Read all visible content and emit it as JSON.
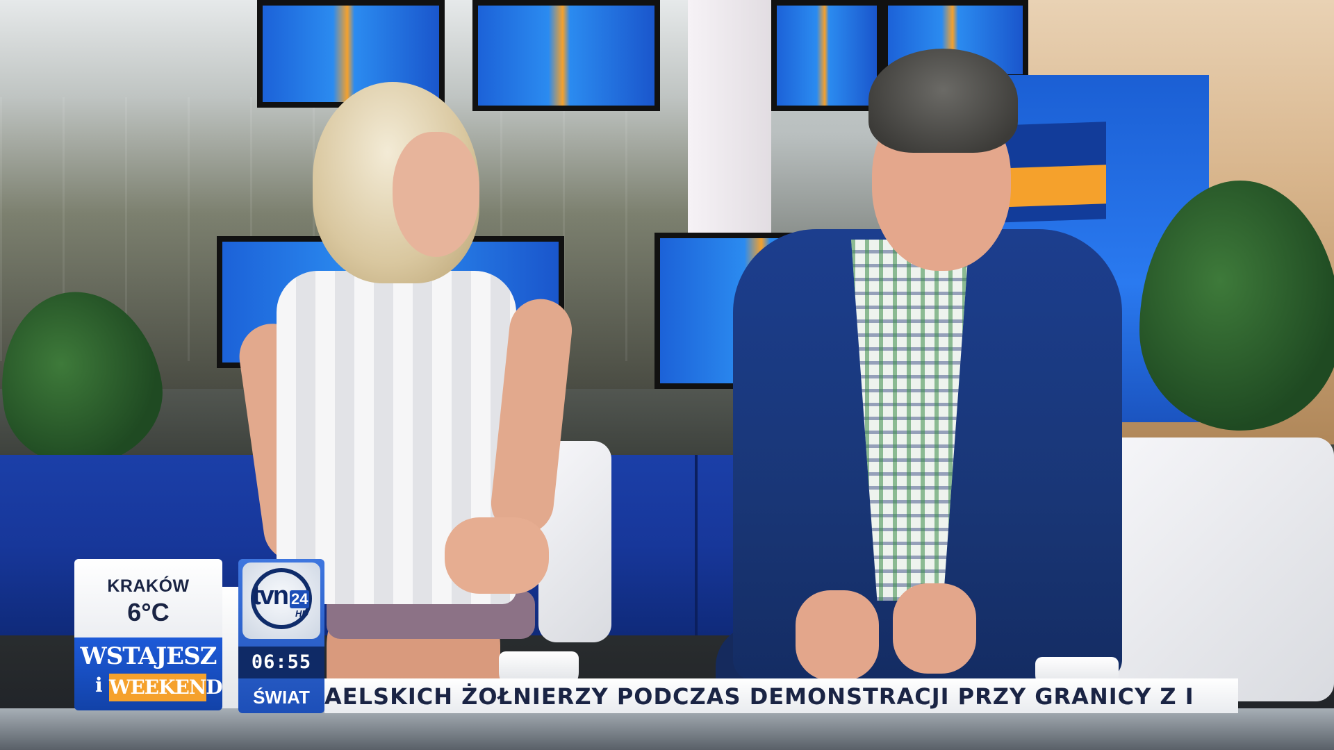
{
  "overlay": {
    "weather": {
      "city": "KRAKÓW",
      "temperature": "6°C"
    },
    "show": {
      "title": "WSTAJESZ",
      "title_i": "i",
      "subtitle": "WEEKEND"
    },
    "channel": {
      "name": "tvn",
      "number": "24",
      "quality": "HD",
      "time": "06:55",
      "section": "ŚWIAT"
    },
    "ticker": {
      "text": "AELSKICH ŻOŁNIERZY PODCZAS DEMONSTRACJI PRZY GRANICY Z I"
    }
  },
  "colors": {
    "overlay_blue": "#1d4fb8",
    "overlay_navy": "#0f2a66",
    "accent_orange": "#f5a12c",
    "text_dark": "#1a2444"
  }
}
